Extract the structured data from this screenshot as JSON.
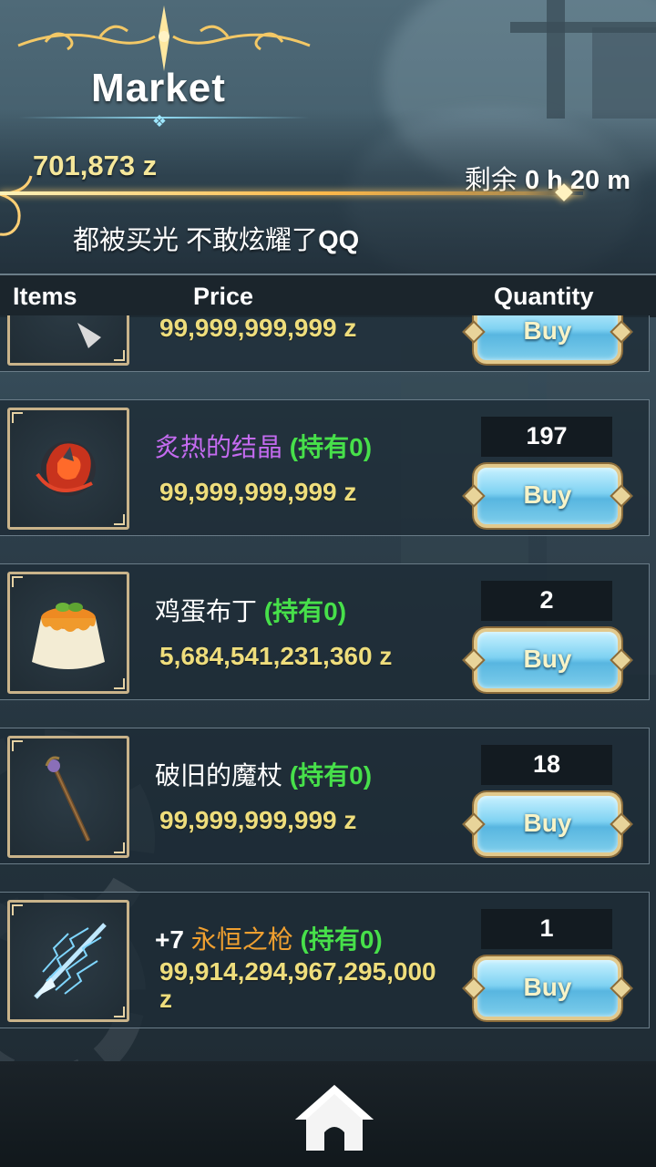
{
  "header": {
    "title": "Market",
    "money": "701,873 z",
    "timer_label": "剩余",
    "timer_value": "0 h 20 m",
    "notice_text": "都被买光 不敢炫耀了",
    "notice_bold": "QQ"
  },
  "columns": {
    "items": "Items",
    "price": "Price",
    "quantity": "Quantity"
  },
  "items": [
    {
      "prefix": "",
      "name": "",
      "hold": "",
      "price": "99,999,999,999 z",
      "quantity": "",
      "buy_label": "Buy",
      "icon": "partial-item-icon"
    },
    {
      "prefix": "",
      "name": "炙热的结晶",
      "name_color": "#c46bf0",
      "hold": "(持有0)",
      "price": "99,999,999,999 z",
      "quantity": "197",
      "buy_label": "Buy",
      "icon": "fire-crystal-icon"
    },
    {
      "prefix": "",
      "name": "鸡蛋布丁",
      "name_color": "#ffffff",
      "hold": "(持有0)",
      "price": "5,684,541,231,360 z",
      "quantity": "2",
      "buy_label": "Buy",
      "icon": "pudding-icon"
    },
    {
      "prefix": "",
      "name": "破旧的魔杖",
      "name_color": "#ffffff",
      "hold": "(持有0)",
      "price": "99,999,999,999 z",
      "quantity": "18",
      "buy_label": "Buy",
      "icon": "magic-staff-icon"
    },
    {
      "prefix": "+7",
      "name": "永恒之枪",
      "name_color": "#f0a030",
      "hold": "(持有0)",
      "price": "99,914,294,967,295,000 z",
      "quantity": "1",
      "buy_label": "Buy",
      "icon": "lightning-spear-icon"
    }
  ],
  "footer": {
    "home_icon": "home-icon"
  },
  "colors": {
    "price": "#eedd7c",
    "hold": "#47e04a",
    "money": "#f5e79a",
    "gold": "#ffb94a"
  }
}
